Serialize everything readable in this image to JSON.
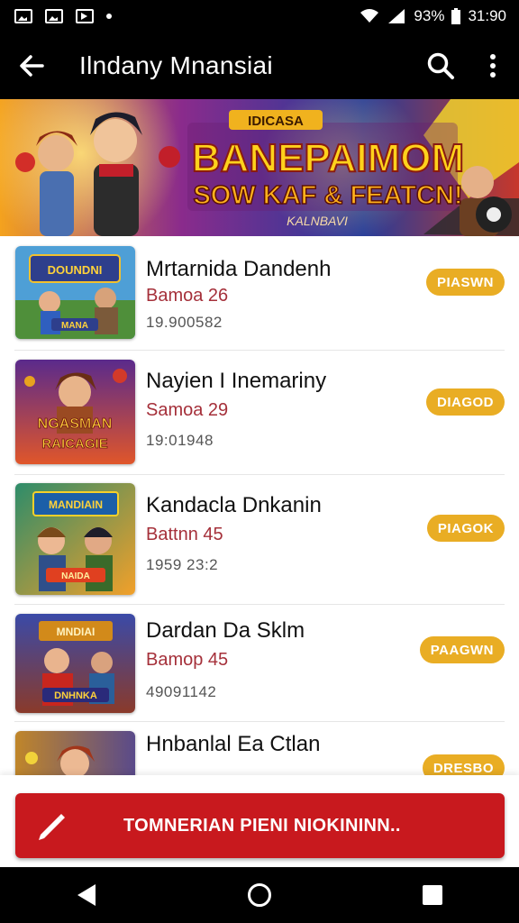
{
  "status_bar": {
    "battery_percent": "93%",
    "time": "31:90",
    "icons": [
      "gallery-icon",
      "image-icon",
      "play-store-icon",
      "notification-dot-icon",
      "wifi-icon",
      "signal-icon",
      "battery-icon"
    ]
  },
  "app_bar": {
    "title": "Ilndany Mnansiai",
    "icons": [
      "back-arrow-icon",
      "search-icon",
      "more-vert-icon"
    ]
  },
  "banner": {
    "top_text": "IDICASA",
    "headline": "BANEPAIMOM",
    "subheadline": "SOW KAF & FEATCN!",
    "caption": "KALNBAVI"
  },
  "items": [
    {
      "title": "Mrtarnida Dandenh",
      "subtitle": "Bamoa 26",
      "number": "19.900582",
      "badge": "PIASWN",
      "thumb_text": [
        "DOUNDNI",
        "MANA"
      ]
    },
    {
      "title": "Nayien I Inemariny",
      "subtitle": "Samoa 29",
      "number": "19:01948",
      "badge": "DIAGOD",
      "thumb_text": [
        "NGASMAN",
        "RAICAGIE"
      ]
    },
    {
      "title": "Kandacla Dnkanin",
      "subtitle": "Battnn 45",
      "number": "1959 23:2",
      "badge": "PIAGOK",
      "thumb_text": [
        "MANDIAIN",
        "NAIDA"
      ]
    },
    {
      "title": "Dardan Da Sklm",
      "subtitle": "Bamop 45",
      "number": "49091142",
      "badge": "PAAGWN",
      "thumb_text": [
        "MNDIAI",
        "DNHNKA"
      ]
    },
    {
      "title": "Hnbanlal Ea Ctlan",
      "subtitle": "",
      "number": "",
      "badge": "DRESBO",
      "thumb_text": []
    }
  ],
  "cta": {
    "label": "TOMNERIAN PIENI NIOKININN..",
    "icon": "pencil-icon",
    "color": "#c8191e"
  },
  "nav_bar": {
    "icons": [
      "nav-back-icon",
      "nav-home-icon",
      "nav-recents-icon"
    ]
  },
  "colors": {
    "badge": "#e9ad24",
    "subtitle": "#a5303a",
    "bars": "#000000"
  }
}
